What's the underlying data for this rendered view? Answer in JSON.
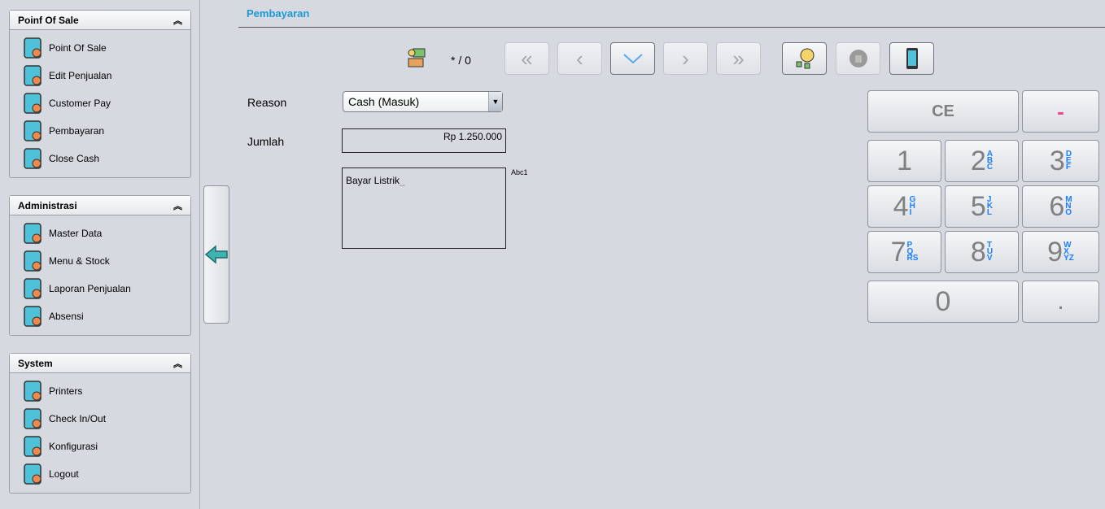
{
  "sidebar": {
    "panels": [
      {
        "title": "Poinf Of Sale",
        "items": [
          {
            "label": "Point Of Sale",
            "icon": "pos-tablet-icon"
          },
          {
            "label": "Edit Penjualan",
            "icon": "phone-edit-icon"
          },
          {
            "label": "Customer Pay",
            "icon": "card-payment-icon"
          },
          {
            "label": "Pembayaran",
            "icon": "payment-board-icon"
          },
          {
            "label": "Close Cash",
            "icon": "cash-register-icon"
          }
        ]
      },
      {
        "title": "Administrasi",
        "items": [
          {
            "label": "Master Data",
            "icon": "rocket-gear-icon"
          },
          {
            "label": "Menu & Stock",
            "icon": "meat-icon"
          },
          {
            "label": "Laporan Penjualan",
            "icon": "cloche-icon"
          },
          {
            "label": "Absensi",
            "icon": "chef-icon"
          }
        ]
      },
      {
        "title": "System",
        "items": [
          {
            "label": "Printers",
            "icon": "phone-wifi-icon"
          },
          {
            "label": "Check In/Out",
            "icon": "phone-wifi-icon"
          },
          {
            "label": "Konfigurasi",
            "icon": "globe-gear-icon"
          },
          {
            "label": "Logout",
            "icon": "alarm-light-icon"
          }
        ]
      }
    ]
  },
  "main": {
    "title": "Pembayaran",
    "record_counter": "* / 0",
    "form": {
      "reason_label": "Reason",
      "reason_value": "Cash (Masuk)",
      "jumlah_label": "Jumlah",
      "jumlah_value": "Rp 1.250.000",
      "notes_value": "Bayar Listrik",
      "input_mode": "Abc1"
    },
    "keypad": {
      "ce": "CE",
      "minus": "-",
      "zero": "0",
      "dot": ".",
      "digits": [
        {
          "d": "1",
          "l": []
        },
        {
          "d": "2",
          "l": [
            "A",
            "B",
            "C"
          ]
        },
        {
          "d": "3",
          "l": [
            "D",
            "E",
            "F"
          ]
        },
        {
          "d": "4",
          "l": [
            "G",
            "H",
            "I"
          ]
        },
        {
          "d": "5",
          "l": [
            "J",
            "K",
            "L"
          ]
        },
        {
          "d": "6",
          "l": [
            "M",
            "N",
            "O"
          ]
        },
        {
          "d": "7",
          "l": [
            "P",
            "Q",
            "RS"
          ]
        },
        {
          "d": "8",
          "l": [
            "T",
            "U",
            "V"
          ]
        },
        {
          "d": "9",
          "l": [
            "W",
            "X",
            "YZ"
          ]
        }
      ]
    },
    "colors": {
      "accent": "#1b9ad6",
      "minus": "#f0468c",
      "letters": "#1a7fff"
    }
  }
}
